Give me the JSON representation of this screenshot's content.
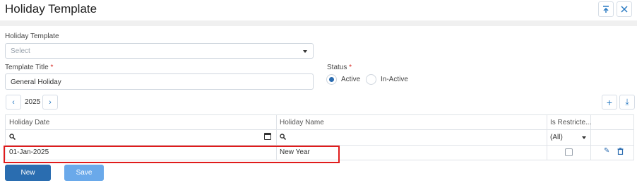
{
  "header": {
    "title": "Holiday Template",
    "collapse_icon": "collapse-up-icon",
    "close_icon": "close-icon"
  },
  "form": {
    "holiday_template_label": "Holiday Template",
    "holiday_template_placeholder": "Select",
    "template_title_label": "Template Title",
    "template_title_value": "General Holiday",
    "required_mark": "*",
    "status_label": "Status",
    "status_options": [
      {
        "label": "Active",
        "selected": true
      },
      {
        "label": "In-Active",
        "selected": false
      }
    ]
  },
  "year_nav": {
    "prev_glyph": "‹",
    "year": "2025",
    "next_glyph": "›"
  },
  "toolbar": {
    "add_glyph": "+",
    "download_glyph": "⤓"
  },
  "grid": {
    "columns": [
      "Holiday Date",
      "Holiday Name",
      "Is Restricte..."
    ],
    "filter_all": "(All)",
    "rows": [
      {
        "date": "01-Jan-2025",
        "name": "New Year",
        "restricted": false
      }
    ],
    "edit_glyph": "✎",
    "delete_glyph": "🗑"
  },
  "actions": {
    "new_label": "New",
    "save_label": "Save"
  },
  "colors": {
    "primary": "#2a6db0",
    "secondary": "#6aa9ea",
    "highlight": "#e01b1b"
  }
}
